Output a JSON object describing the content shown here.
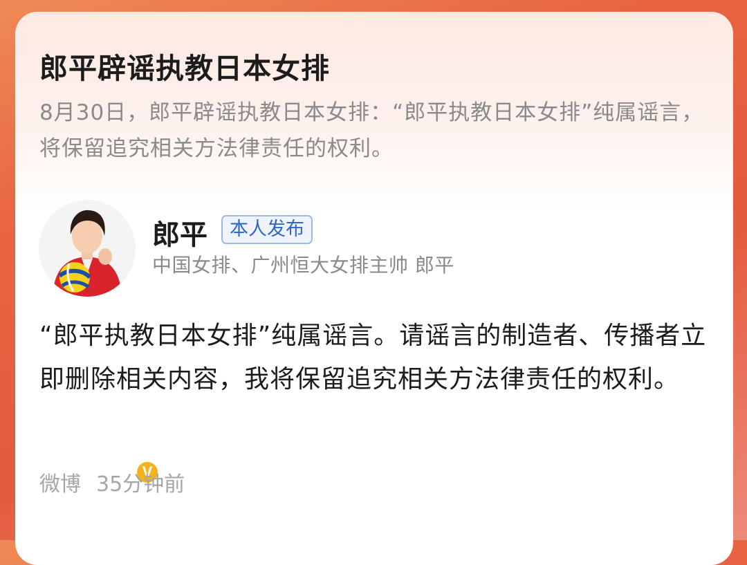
{
  "headline": "郎平辟谣执教日本女排",
  "summary": "8月30日，郎平辟谣执教日本女排：“郎平执教日本女排”纯属谣言，将保留追究相关方法律责任的权利。",
  "author": {
    "name": "郎平",
    "badge": "本人发布",
    "title": "中国女排、广州恒大女排主帅 郎平",
    "verified_mark": "V"
  },
  "post": {
    "text": "“郎平执教日本女排”纯属谣言。请谣言的制造者、传播者立即删除相关内容，我将保留追究相关方法律责任的权利。"
  },
  "meta": {
    "source": "微博",
    "time": "35分钟前"
  },
  "colors": {
    "badge_blue": "#2f66cc",
    "verified_gold": "#f5b21a",
    "background_red": "#e45a3d"
  }
}
